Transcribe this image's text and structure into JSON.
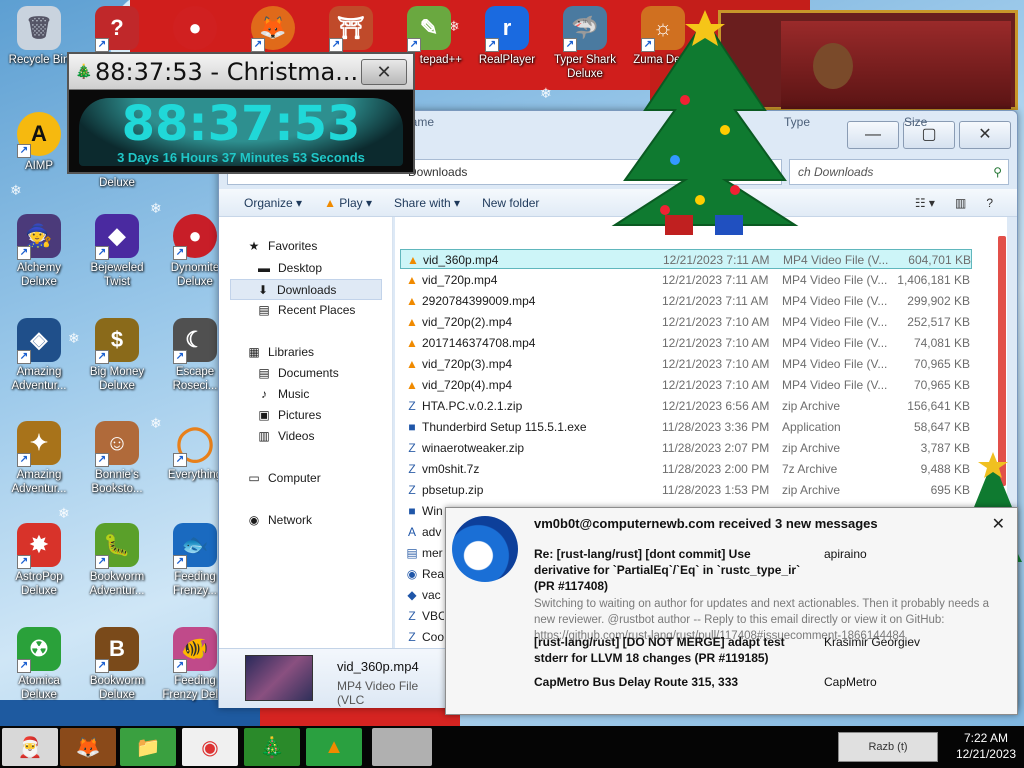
{
  "desktop_icons": [
    {
      "label": "Recycle Bin",
      "glyph": "🗑",
      "bg": "#c9d3de"
    },
    {
      "label": "AIMP",
      "glyph": "A",
      "bg": "#f6b90f"
    },
    {
      "label": "Alchemy Deluxe",
      "glyph": "🧙",
      "bg": "#4b3a7a"
    },
    {
      "label": "Amazing Adventur...",
      "glyph": "◈",
      "bg": "#1f4f8a"
    },
    {
      "label": "Amazing Adventur...",
      "glyph": "✦",
      "bg": "#a8731a"
    },
    {
      "label": "AstroPop Deluxe",
      "glyph": "✸",
      "bg": "#d8332a"
    },
    {
      "label": "Atomica Deluxe",
      "glyph": "☢",
      "bg": "#2aa13a"
    },
    {
      "label": "Deluxe",
      "glyph": "?",
      "bg": "#c0282a"
    },
    {
      "label": "Bejeweled Twist",
      "glyph": "◆",
      "bg": "#4a2aa0"
    },
    {
      "label": "Big Money Deluxe",
      "glyph": "$",
      "bg": "#8a6a1a"
    },
    {
      "label": "Bonnie's Booksto...",
      "glyph": "☺",
      "bg": "#b06a3a"
    },
    {
      "label": "Bookworm Adventur...",
      "glyph": "🐛",
      "bg": "#5aa02a"
    },
    {
      "label": "Bookworm Deluxe",
      "glyph": "B",
      "bg": "#7a4a1a"
    },
    {
      "label": "Dynomite Deluxe",
      "glyph": "●",
      "bg": "#c81e28"
    },
    {
      "label": "Escape Roseci...",
      "glyph": "☾",
      "bg": "#505050"
    },
    {
      "label": "Everything",
      "glyph": "◯",
      "bg": "#e8801a"
    },
    {
      "label": "Feeding Frenzy...",
      "glyph": "🐟",
      "bg": "#1a6ac0"
    },
    {
      "label": "Feeding Frenzy Del...",
      "glyph": "🐠",
      "bg": "#c04a8a"
    },
    {
      "label": "Notepad++",
      "glyph": "✎",
      "bg": "#6aa840"
    },
    {
      "label": "RealPlayer",
      "glyph": "r",
      "bg": "#1a6ae0"
    },
    {
      "label": "Typer Shark Deluxe",
      "glyph": "🦈",
      "bg": "#4a7aa0"
    },
    {
      "label": "Zuma Del...",
      "glyph": "☼",
      "bg": "#d07020"
    }
  ],
  "countdown": {
    "title": "88:37:53 - Christma...",
    "time": "88:37:53",
    "detail": "3 Days 16 Hours 37 Minutes 53 Seconds",
    "close": "✕"
  },
  "explorer": {
    "address_crumb": "Downloads",
    "search_placeholder": "ch Downloads",
    "commands": [
      "Organize ▾",
      "Play ▾",
      "Share with ▾",
      "New folder"
    ],
    "command_icons": [
      "☷ ▾",
      "▥",
      "?"
    ],
    "buttons": {
      "minimize": "—",
      "maximize": "▢",
      "close": "✕"
    },
    "nav": [
      {
        "label": "Favorites",
        "icon": "★"
      },
      {
        "label": "Desktop",
        "icon": "▬"
      },
      {
        "label": "Downloads",
        "icon": "⬇"
      },
      {
        "label": "Recent Places",
        "icon": "▤"
      },
      {
        "label": "Libraries",
        "icon": "▦"
      },
      {
        "label": "Documents",
        "icon": "▤"
      },
      {
        "label": "Music",
        "icon": "♪"
      },
      {
        "label": "Pictures",
        "icon": "▣"
      },
      {
        "label": "Videos",
        "icon": "▥"
      },
      {
        "label": "Computer",
        "icon": "▭"
      },
      {
        "label": "Network",
        "icon": "◉"
      }
    ],
    "columns": {
      "name": "Name",
      "type": "Type",
      "size": "Size"
    },
    "files": [
      {
        "name": "vid_360p.mp4",
        "date": "12/21/2023 7:11 AM",
        "type": "MP4 Video File (V...",
        "size": "604,701 KB",
        "icon": "▲",
        "kind": "vlc"
      },
      {
        "name": "vid_720p.mp4",
        "date": "12/21/2023 7:11 AM",
        "type": "MP4 Video File (V...",
        "size": "1,406,181 KB",
        "icon": "▲",
        "kind": "vlc"
      },
      {
        "name": "2920784399009.mp4",
        "date": "12/21/2023 7:11 AM",
        "type": "MP4 Video File (V...",
        "size": "299,902 KB",
        "icon": "▲",
        "kind": "vlc"
      },
      {
        "name": "vid_720p(2).mp4",
        "date": "12/21/2023 7:10 AM",
        "type": "MP4 Video File (V...",
        "size": "252,517 KB",
        "icon": "▲",
        "kind": "vlc"
      },
      {
        "name": "2017146374708.mp4",
        "date": "12/21/2023 7:10 AM",
        "type": "MP4 Video File (V...",
        "size": "74,081 KB",
        "icon": "▲",
        "kind": "vlc"
      },
      {
        "name": "vid_720p(3).mp4",
        "date": "12/21/2023 7:10 AM",
        "type": "MP4 Video File (V...",
        "size": "70,965 KB",
        "icon": "▲",
        "kind": "vlc"
      },
      {
        "name": "vid_720p(4).mp4",
        "date": "12/21/2023 7:10 AM",
        "type": "MP4 Video File (V...",
        "size": "70,965 KB",
        "icon": "▲",
        "kind": "vlc"
      },
      {
        "name": "HTA.PC.v.0.2.1.zip",
        "date": "12/21/2023 6:56 AM",
        "type": "zip Archive",
        "size": "156,641 KB",
        "icon": "Z",
        "kind": "zip"
      },
      {
        "name": "Thunderbird Setup 115.5.1.exe",
        "date": "11/28/2023 3:36 PM",
        "type": "Application",
        "size": "58,647 KB",
        "icon": "■",
        "kind": "exe"
      },
      {
        "name": "winaerotweaker.zip",
        "date": "11/28/2023 2:07 PM",
        "type": "zip Archive",
        "size": "3,787 KB",
        "icon": "Z",
        "kind": "zip"
      },
      {
        "name": "vm0shit.7z",
        "date": "11/28/2023 2:00 PM",
        "type": "7z Archive",
        "size": "9,488 KB",
        "icon": "Z",
        "kind": "zip"
      },
      {
        "name": "pbsetup.zip",
        "date": "11/28/2023 1:53 PM",
        "type": "zip Archive",
        "size": "695 KB",
        "icon": "Z",
        "kind": "zip"
      },
      {
        "name": "Win",
        "date": "",
        "type": "",
        "size": "",
        "icon": "■",
        "kind": "exe"
      },
      {
        "name": "adv",
        "date": "",
        "type": "",
        "size": "",
        "icon": "A",
        "kind": "exe"
      },
      {
        "name": "mer",
        "date": "",
        "type": "",
        "size": "",
        "icon": "▤",
        "kind": "zip"
      },
      {
        "name": "Rea",
        "date": "",
        "type": "",
        "size": "",
        "icon": "◉",
        "kind": "exe"
      },
      {
        "name": "vac",
        "date": "",
        "type": "",
        "size": "",
        "icon": "◆",
        "kind": "exe"
      },
      {
        "name": "VBC",
        "date": "",
        "type": "",
        "size": "",
        "icon": "Z",
        "kind": "zip"
      },
      {
        "name": "Coo",
        "date": "",
        "type": "",
        "size": "",
        "icon": "Z",
        "kind": "zip"
      }
    ],
    "details": {
      "name": "vid_360p.mp4",
      "type": "MP4 Video File (VLC"
    }
  },
  "notification": {
    "header": "vm0b0t@computernewb.com received 3 new messages",
    "close": "✕",
    "messages": [
      {
        "subject": "Re: [rust-lang/rust] [dont commit] Use derivative for `PartialEq`/`Eq` in `rustc_type_ir` (PR #117408)",
        "from": "apiraino",
        "preview": "Switching to waiting on author for updates and next actionables. Then it probably needs a new reviewer. @rustbot author -- Reply to this email directly or view it on GitHub: https://github.com/rust-lang/rust/pull/117408#issuecomment-1866144484"
      },
      {
        "subject": "[rust-lang/rust] [DO NOT MERGE] adapt test stderr for LLVM 18 changes (PR #119185)",
        "from": "Krasimir Georgiev",
        "preview": ""
      },
      {
        "subject": "CapMetro Bus Delay Route 315, 333",
        "from": "CapMetro",
        "preview": ""
      }
    ]
  },
  "taskbar": {
    "items": [
      {
        "name": "santa",
        "glyph": "🎅",
        "bg": "#d8d8d8"
      },
      {
        "name": "firefox",
        "glyph": "🦊",
        "bg": "#8a4a1a"
      },
      {
        "name": "explorer",
        "glyph": "📁",
        "bg": "#3aa040"
      },
      {
        "name": "chrome",
        "glyph": "◉",
        "bg": "#f0f0f0"
      },
      {
        "name": "tree",
        "glyph": "🎄",
        "bg": "#2a8a2a"
      },
      {
        "name": "vlc",
        "glyph": "▲",
        "bg": "#2aa040"
      },
      {
        "name": "blank",
        "glyph": "",
        "bg": "#b0b0b0"
      }
    ],
    "tray_label": "Razb (t)",
    "time": "7:22 AM",
    "date": "12/21/2023"
  }
}
